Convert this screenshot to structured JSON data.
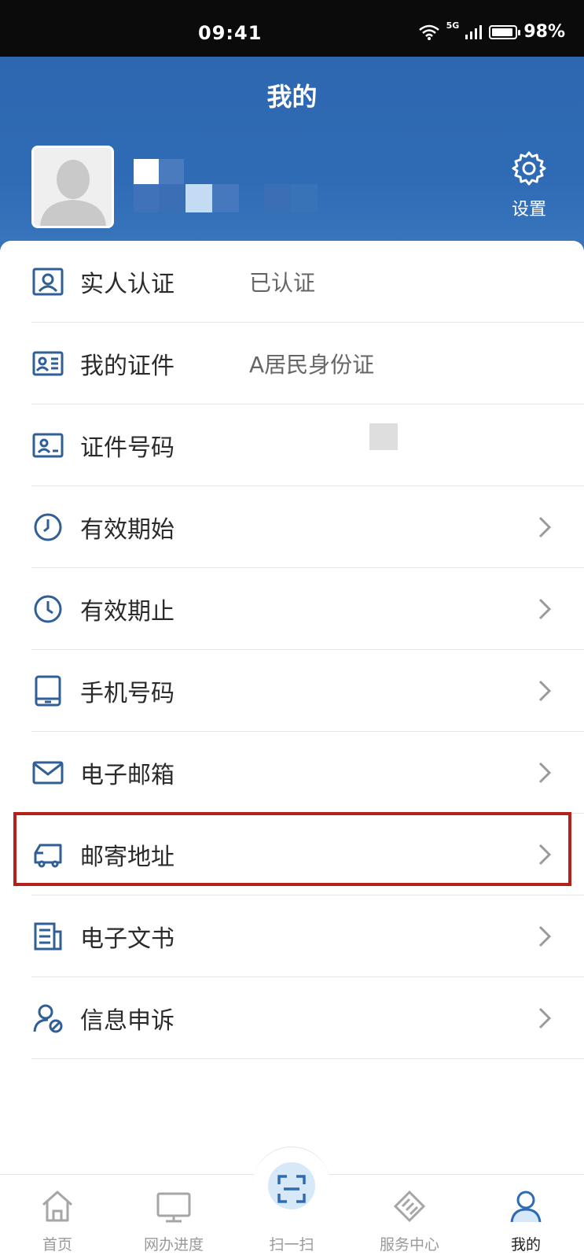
{
  "status_bar": {
    "time": "09:41",
    "network": "5G",
    "battery": "98%"
  },
  "header": {
    "title": "我的"
  },
  "profile": {
    "settings_label": "设置"
  },
  "menu": [
    {
      "label": "实人认证",
      "value": "已认证",
      "icon": "person-id-icon",
      "chevron": false
    },
    {
      "label": "我的证件",
      "value": "A居民身份证",
      "icon": "id-card-icon",
      "chevron": false
    },
    {
      "label": "证件号码",
      "value": "",
      "icon": "id-number-icon",
      "chevron": false
    },
    {
      "label": "有效期始",
      "value": "",
      "icon": "clock-start-icon",
      "chevron": true
    },
    {
      "label": "有效期止",
      "value": "",
      "icon": "clock-end-icon",
      "chevron": true
    },
    {
      "label": "手机号码",
      "value": "",
      "icon": "phone-icon",
      "chevron": true
    },
    {
      "label": "电子邮箱",
      "value": "",
      "icon": "mail-icon",
      "chevron": true
    },
    {
      "label": "邮寄地址",
      "value": "",
      "icon": "truck-icon",
      "chevron": true
    },
    {
      "label": "电子文书",
      "value": "",
      "icon": "document-icon",
      "chevron": true
    },
    {
      "label": "信息申诉",
      "value": "",
      "icon": "user-appeal-icon",
      "chevron": true
    }
  ],
  "tabbar": {
    "tabs": [
      {
        "label": "首页",
        "icon": "home-icon"
      },
      {
        "label": "网办进度",
        "icon": "monitor-icon"
      },
      {
        "label": "扫一扫",
        "icon": "scan-icon"
      },
      {
        "label": "服务中心",
        "icon": "service-icon"
      },
      {
        "label": "我的",
        "icon": "profile-icon"
      }
    ],
    "active": "我的"
  },
  "colors": {
    "header_blue": "#2e67b0",
    "icon_blue": "#2f5f96",
    "highlight_red": "#b3211a"
  }
}
